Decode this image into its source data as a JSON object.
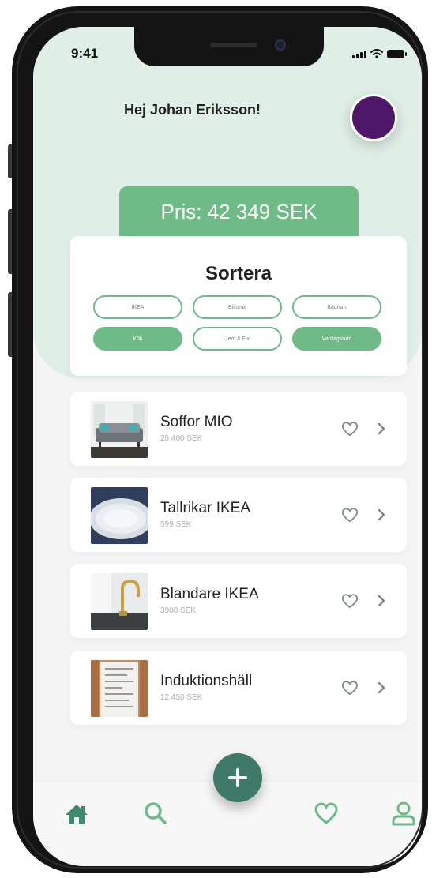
{
  "status": {
    "time": "9:41"
  },
  "header": {
    "greeting": "Hej Johan Eriksson!"
  },
  "price": {
    "label": "Pris: 42 349 SEK"
  },
  "sort": {
    "title": "Sortera",
    "chips": [
      {
        "label": "IKEA",
        "active": false
      },
      {
        "label": "Billoma",
        "active": false
      },
      {
        "label": "Badrum",
        "active": false
      },
      {
        "label": "Kök",
        "active": true
      },
      {
        "label": "Jem & Fix",
        "active": false
      },
      {
        "label": "Vardagsrum",
        "active": true
      }
    ]
  },
  "items": [
    {
      "title": "Soffor MIO",
      "price": "25 400 SEK",
      "image": "sofa-photo"
    },
    {
      "title": "Tallrikar IKEA",
      "price": "599 SEK",
      "image": "plate-photo"
    },
    {
      "title": "Blandare IKEA",
      "price": "3900 SEK",
      "image": "faucet-photo"
    },
    {
      "title": "Induktionshäll",
      "price": "12 450 SEK",
      "image": "receipt-photo"
    }
  ],
  "nav": {
    "items": [
      "home-icon",
      "search-icon",
      "add-icon",
      "heart-icon",
      "profile-icon"
    ]
  },
  "colors": {
    "accent": "#6fbb88",
    "fab": "#3e7a67",
    "header_bg": "#dfeee6",
    "avatar": "#4e1769"
  }
}
